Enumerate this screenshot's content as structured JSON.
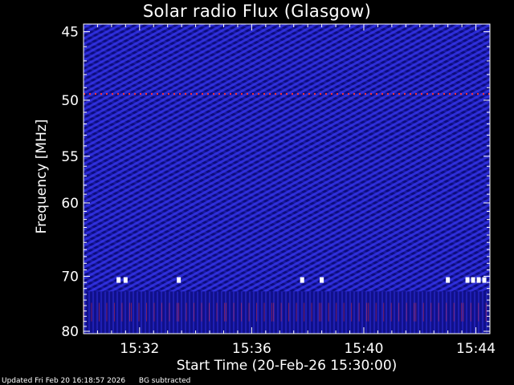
{
  "chart_data": {
    "type": "heatmap",
    "title": "Solar radio Flux (Glasgow)",
    "xlabel": "Start Time (20-Feb-26 15:30:00)",
    "ylabel": "Frequency [MHz]",
    "x_ticks": [
      "15:32",
      "15:36",
      "15:40",
      "15:44"
    ],
    "x_tick_minutes": [
      2,
      6,
      10,
      14
    ],
    "xlim_minutes": [
      0,
      14.5
    ],
    "y_ticks": [
      45,
      50,
      55,
      60,
      70,
      80
    ],
    "ylim": [
      44.5,
      80.5
    ],
    "y_scale": "reciprocal",
    "colors": {
      "background": "#000000",
      "spectrogram_base": "#1a1aa0",
      "spectrogram_light": "#3b3bff",
      "spectrogram_dark": "#000060",
      "interference": "#ff3030",
      "saturated": "#ffffff"
    },
    "interference_lines_mhz": [
      49.5
    ],
    "bright_bursts": [
      {
        "time_minutes": 1.25,
        "freq_mhz": 70.6
      },
      {
        "time_minutes": 1.5,
        "freq_mhz": 70.6
      },
      {
        "time_minutes": 3.4,
        "freq_mhz": 70.6
      },
      {
        "time_minutes": 7.8,
        "freq_mhz": 70.6
      },
      {
        "time_minutes": 8.5,
        "freq_mhz": 70.6
      },
      {
        "time_minutes": 13.0,
        "freq_mhz": 70.6
      },
      {
        "time_minutes": 13.7,
        "freq_mhz": 70.6
      },
      {
        "time_minutes": 13.9,
        "freq_mhz": 70.6
      },
      {
        "time_minutes": 14.1,
        "freq_mhz": 70.6
      },
      {
        "time_minutes": 14.3,
        "freq_mhz": 70.6
      }
    ]
  },
  "footer": {
    "updated": "Updated Fri Feb 20 16:18:57 2026",
    "note": "BG subtracted"
  }
}
